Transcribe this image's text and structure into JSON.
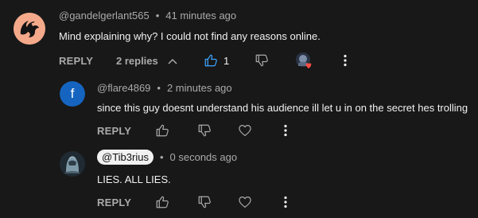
{
  "comments": [
    {
      "handle": "@gandelgerlant565",
      "time": "41 minutes ago",
      "text": "Mind explaining why? I could not find any reasons online.",
      "reply_label": "REPLY",
      "replies_label": "2 replies",
      "like_count": "1",
      "like_icon": "thumb-up-icon",
      "dislike_icon": "thumb-down-icon",
      "creator_heart_icon": "creator-heart-icon",
      "more_icon": "more-vert-icon"
    },
    {
      "handle": "@flare4869",
      "time": "2 minutes ago",
      "text": "since this guy doesnt understand his audience ill let u in on the secret hes trolling",
      "reply_label": "REPLY",
      "avatar_letter": "f",
      "avatar_color": "#1565c0"
    },
    {
      "handle": "@Tib3rius",
      "time": "0 seconds ago",
      "text": "LIES. ALL LIES.",
      "reply_label": "REPLY"
    }
  ],
  "colors": {
    "background": "#181818",
    "text_primary": "#f1f1f1",
    "text_secondary": "#aaaaaa",
    "like_active": "#3ea6ff",
    "heart": "#ff4e45"
  }
}
